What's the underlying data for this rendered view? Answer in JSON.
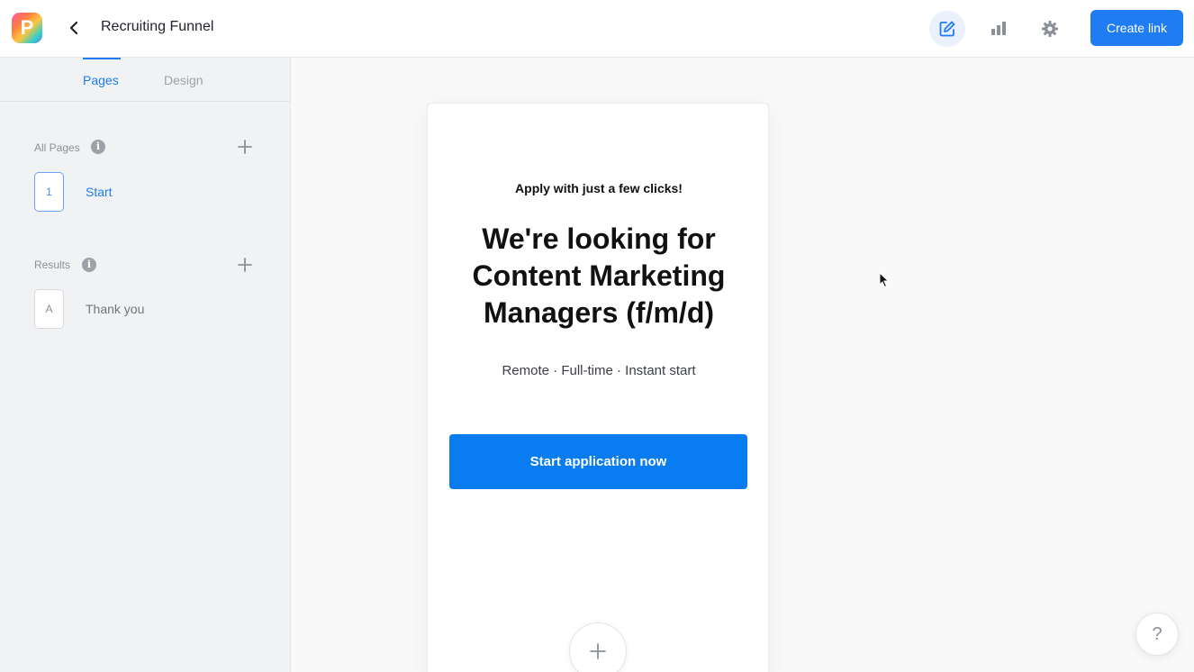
{
  "app": {
    "logo_letter": "P",
    "title": "Recruiting Funnel"
  },
  "header": {
    "icons": [
      "edit-icon",
      "bar-chart-icon",
      "gear-icon"
    ],
    "create_link_label": "Create link"
  },
  "sidebar": {
    "tabs": [
      {
        "label": "Pages",
        "active": true
      },
      {
        "label": "Design",
        "active": false
      }
    ],
    "all_pages": {
      "label": "All Pages",
      "items": [
        {
          "badge": "1",
          "name": "Start",
          "active": true
        }
      ]
    },
    "results": {
      "label": "Results",
      "items": [
        {
          "badge": "A",
          "name": "Thank you",
          "active": false
        }
      ]
    }
  },
  "canvas": {
    "kicker": "Apply with just a few clicks!",
    "headline": "We're looking for Content Marketing Managers (f/m/d)",
    "subline": "Remote · Full-time · Instant start",
    "cta_label": "Start application now"
  },
  "help_label": "?",
  "colors": {
    "accent": "#1f7cf2",
    "cta": "#0a7cf1"
  }
}
